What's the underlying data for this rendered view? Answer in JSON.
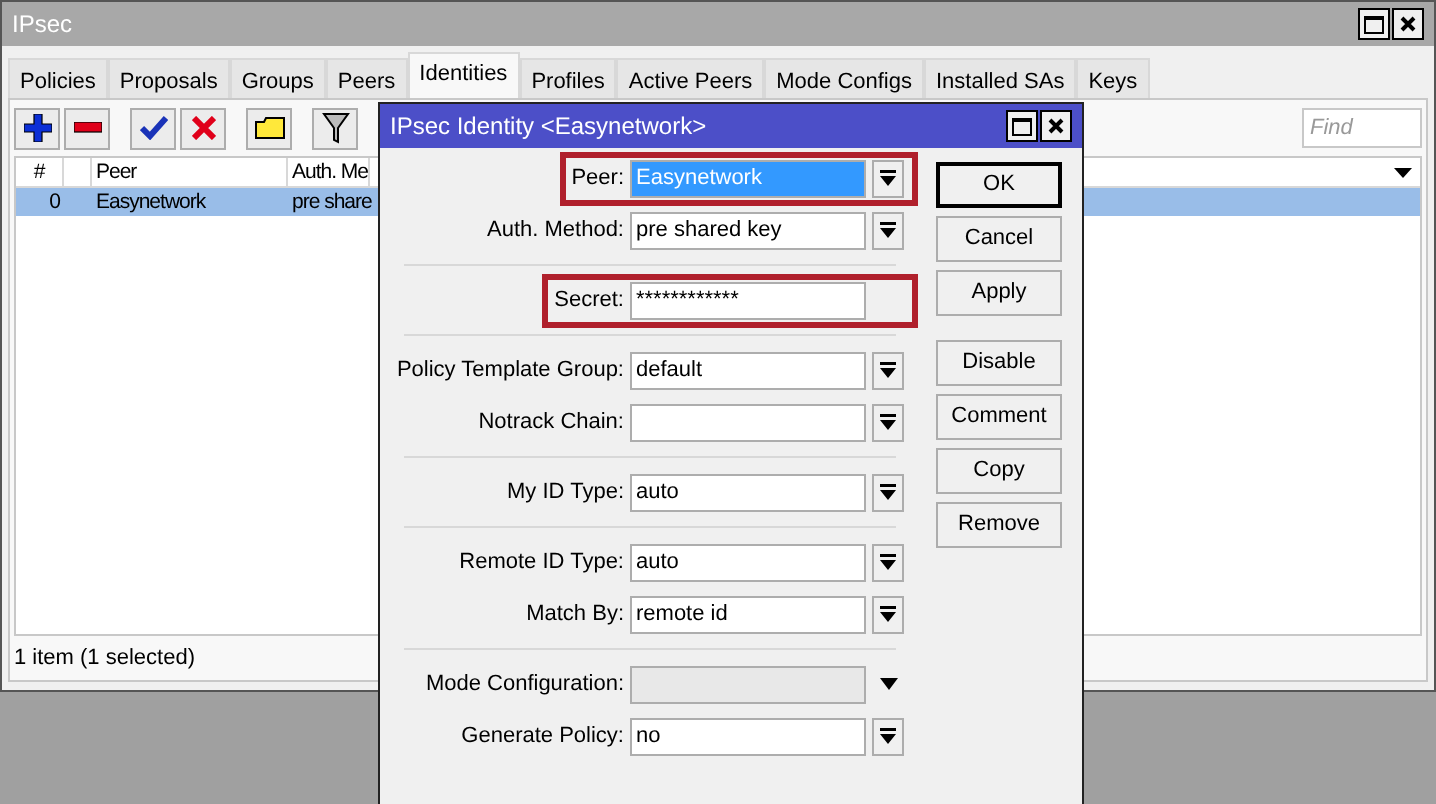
{
  "window": {
    "title": "IPsec"
  },
  "tabs": [
    {
      "label": "Policies",
      "selected": false
    },
    {
      "label": "Proposals",
      "selected": false
    },
    {
      "label": "Groups",
      "selected": false
    },
    {
      "label": "Peers",
      "selected": false
    },
    {
      "label": "Identities",
      "selected": true
    },
    {
      "label": "Profiles",
      "selected": false
    },
    {
      "label": "Active Peers",
      "selected": false
    },
    {
      "label": "Mode Configs",
      "selected": false
    },
    {
      "label": "Installed SAs",
      "selected": false
    },
    {
      "label": "Keys",
      "selected": false
    }
  ],
  "toolbar": [
    {
      "kind": "add"
    },
    {
      "kind": "remove"
    },
    {
      "kind": "enable"
    },
    {
      "kind": "disable"
    },
    {
      "kind": "comment"
    },
    {
      "kind": "filter"
    }
  ],
  "search": {
    "placeholder": "Find"
  },
  "table": {
    "columns": [
      "#",
      "",
      "Peer",
      "Auth. Me"
    ],
    "rows": [
      {
        "cells": [
          "0",
          "",
          "Easynetwork",
          "pre share"
        ],
        "selected": true
      }
    ]
  },
  "status_bar": "1 item (1 selected)",
  "dialog": {
    "title": "IPsec Identity <Easynetwork>",
    "fields": [
      {
        "label": "Peer:",
        "value": "Easynetwork",
        "kind": "dropdown",
        "highlighted": true,
        "focused": true
      },
      {
        "label": "Auth. Method:",
        "value": "pre shared key",
        "kind": "dropdown",
        "highlighted": false,
        "focused": false
      },
      {
        "kind": "separator"
      },
      {
        "label": "Secret:",
        "value": "************",
        "kind": "text",
        "highlighted": true,
        "focused": false
      },
      {
        "kind": "separator"
      },
      {
        "label": "Policy Template Group:",
        "value": "default",
        "kind": "dropdown",
        "highlighted": false,
        "focused": false
      },
      {
        "label": "Notrack Chain:",
        "kind": "dropdown",
        "highlighted": false,
        "focused": false
      },
      {
        "kind": "separator"
      },
      {
        "label": "My ID Type:",
        "value": "auto",
        "kind": "dropdown",
        "highlighted": false,
        "focused": false
      },
      {
        "kind": "separator"
      },
      {
        "label": "Remote ID Type:",
        "value": "auto",
        "kind": "dropdown",
        "highlighted": false,
        "focused": false
      },
      {
        "label": "Match By:",
        "value": "remote id",
        "kind": "dropdown",
        "highlighted": false,
        "focused": false
      },
      {
        "kind": "separator"
      },
      {
        "label": "Mode Configuration:",
        "kind": "disabled",
        "highlighted": false,
        "focused": false
      },
      {
        "label": "Generate Policy:",
        "value": "no",
        "kind": "dropdown",
        "highlighted": false,
        "focused": false
      }
    ],
    "buttons": [
      {
        "label": "OK",
        "default": true
      },
      {
        "label": "Cancel",
        "default": false
      },
      {
        "label": "Apply",
        "default": false
      },
      {
        "kind": "gap"
      },
      {
        "label": "Disable",
        "default": false
      },
      {
        "label": "Comment",
        "default": false
      },
      {
        "label": "Copy",
        "default": false
      },
      {
        "label": "Remove",
        "default": false
      }
    ]
  }
}
